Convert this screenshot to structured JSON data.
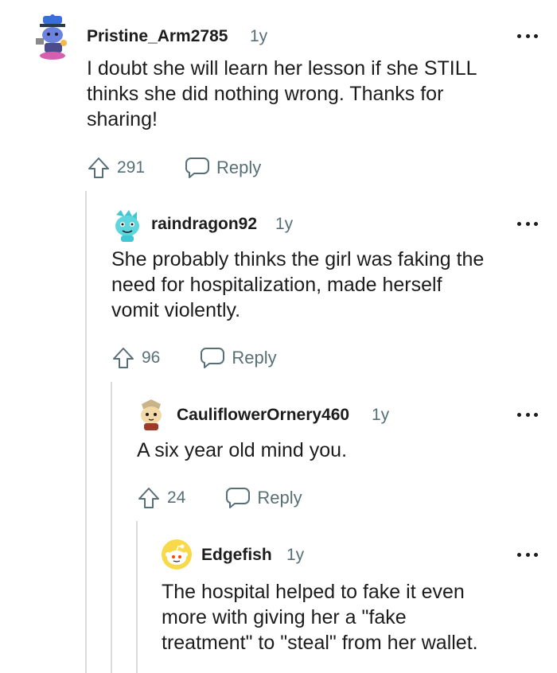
{
  "comments": [
    {
      "username": "Pristine_Arm2785",
      "age": "1y",
      "body": "I doubt she will learn her lesson if she STILL\nthinks she did nothing wrong. Thanks for\nsharing!",
      "votes": "291",
      "reply_label": "Reply",
      "avatar_icon": "snoo-avatar-blue-hat"
    },
    {
      "username": "raindragon92",
      "age": "1y",
      "body": "She probably thinks the girl was faking the\nneed for hospitalization, made herself\nvomit violently.",
      "votes": "96",
      "reply_label": "Reply",
      "avatar_icon": "snoo-avatar-cyan-dragon"
    },
    {
      "username": "CauliflowerOrnery460",
      "age": "1y",
      "body": "A six year old mind you.",
      "votes": "24",
      "reply_label": "Reply",
      "avatar_icon": "snoo-avatar-cat-hat"
    },
    {
      "username": "Edgefish",
      "age": "1y",
      "body": "The hospital helped to fake it even\nmore with giving her a \"fake\ntreatment\" to \"steal\" from her wallet.",
      "votes": "",
      "reply_label": "",
      "avatar_icon": "snoo-avatar-default-yellow"
    }
  ],
  "colors": {
    "text": "#1c1c1c",
    "meta": "#576f76",
    "thread_line": "#d9dadb"
  }
}
